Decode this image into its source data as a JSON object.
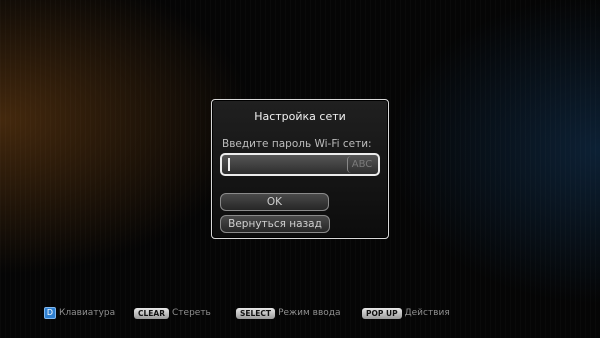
{
  "dialog": {
    "title": "Настройка сети",
    "prompt": "Введите пароль Wi-Fi сети:",
    "password_value": "",
    "input_mode": "ABC",
    "ok_label": "OK",
    "back_label": "Вернуться назад"
  },
  "hints": [
    {
      "key": "D",
      "label": "Клавиатура",
      "key_color": "#2e7fd0"
    },
    {
      "key": "CLEAR",
      "label": "Стереть"
    },
    {
      "key": "SELECT",
      "label": "Режим ввода"
    },
    {
      "key": "POP UP",
      "label": "Действия"
    }
  ]
}
